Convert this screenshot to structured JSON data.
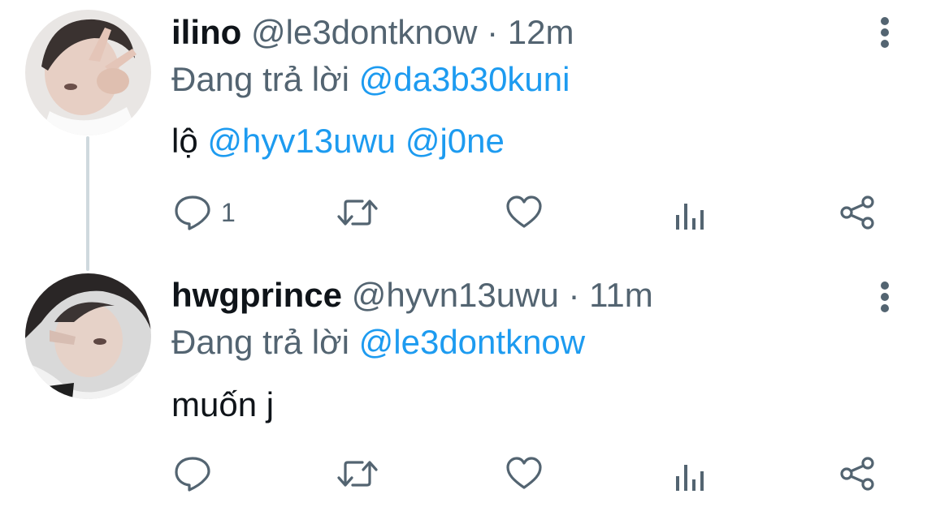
{
  "tweets": [
    {
      "display_name": "ilino",
      "handle": "@le3dontknow",
      "time": "· 12m",
      "reply_prefix": "Đang trả lời",
      "reply_to": "@da3b30kuni",
      "text_plain": "lộ",
      "mentions": [
        "@hyv13uwu",
        "@j0ne"
      ],
      "reply_count": "1",
      "icons": [
        "more-vertical-icon",
        "reply-icon",
        "retweet-icon",
        "like-icon",
        "views-icon",
        "share-icon"
      ]
    },
    {
      "display_name": "hwgprince",
      "handle": "@hyvn13uwu",
      "time": "· 11m",
      "reply_prefix": "Đang trả lời",
      "reply_to": "@le3dontknow",
      "text_plain": "muốn j",
      "reply_count": "",
      "icons": [
        "more-vertical-icon",
        "reply-icon",
        "retweet-icon",
        "like-icon",
        "views-icon",
        "share-icon"
      ]
    }
  ],
  "colors": {
    "text": "#0f1419",
    "secondary": "#536471",
    "link": "#1d9bf0",
    "thread_line": "#cfd9de"
  }
}
